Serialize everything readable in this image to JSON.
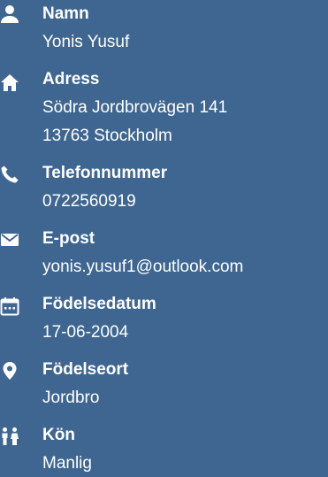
{
  "colors": {
    "background": "#3f6690",
    "text": "#ffffff"
  },
  "fields": [
    {
      "icon": "person-icon",
      "label": "Namn",
      "lines": [
        "Yonis Yusuf"
      ]
    },
    {
      "icon": "home-icon",
      "label": "Adress",
      "lines": [
        "Södra Jordbrovägen 141",
        "13763 Stockholm"
      ]
    },
    {
      "icon": "phone-icon",
      "label": "Telefonnummer",
      "lines": [
        "0722560919"
      ]
    },
    {
      "icon": "envelope-icon",
      "label": "E-post",
      "lines": [
        "yonis.yusuf1@outlook.com"
      ]
    },
    {
      "icon": "calendar-icon",
      "label": "Födelsedatum",
      "lines": [
        "17-06-2004"
      ]
    },
    {
      "icon": "location-pin-icon",
      "label": "Födelseort",
      "lines": [
        "Jordbro"
      ]
    },
    {
      "icon": "people-icon",
      "label": "Kön",
      "lines": [
        "Manlig"
      ]
    }
  ]
}
